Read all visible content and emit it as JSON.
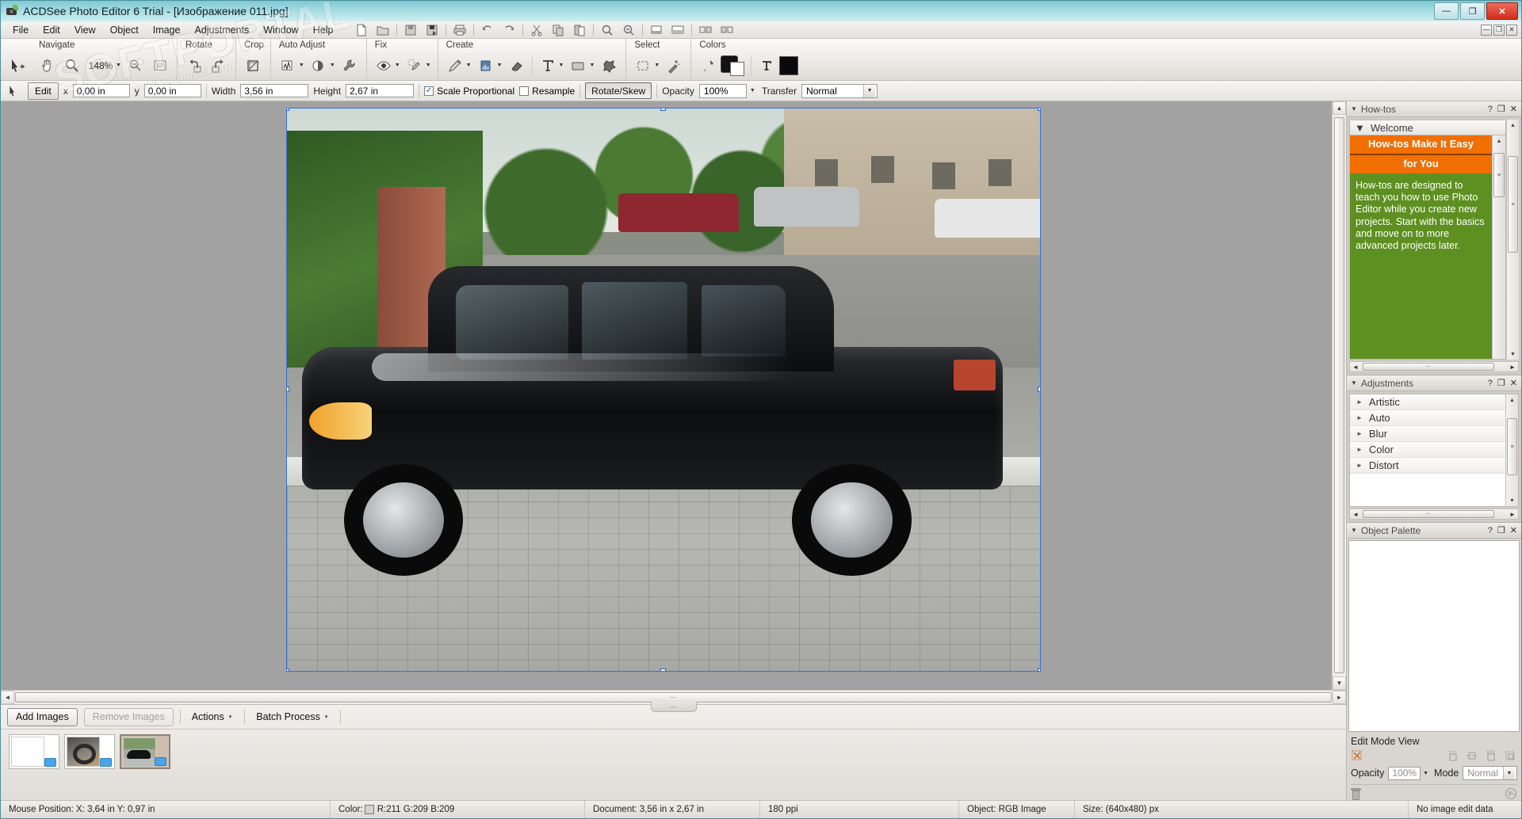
{
  "window": {
    "title": "ACDSee Photo Editor 6 Trial - [Изображение 011.jpg]",
    "app_icon": "camera-icon",
    "minimize": "—",
    "maximize": "❐",
    "close": "✕",
    "doc_restore": "—",
    "doc_max": "❐",
    "doc_close": "✕"
  },
  "menubar": {
    "items": [
      {
        "label": "File"
      },
      {
        "label": "Edit"
      },
      {
        "label": "View"
      },
      {
        "label": "Object"
      },
      {
        "label": "Image"
      },
      {
        "label": "Adjustments"
      },
      {
        "label": "Window"
      },
      {
        "label": "Help"
      }
    ],
    "quick_icons": [
      "new-document-icon",
      "open-folder-icon",
      "save-icon",
      "save-as-icon",
      "print-icon",
      "undo-icon",
      "redo-icon",
      "cut-icon",
      "copy-icon",
      "paste-icon",
      "zoom-in-icon",
      "zoom-out-icon",
      "fit-image-icon",
      "actual-size-icon",
      "compare-icon",
      "toggle-panels-icon"
    ]
  },
  "ribbon": {
    "groups": [
      {
        "label": "Navigate",
        "tools": [
          "select-move-icon",
          "pan-hand-icon",
          "zoom-magnifier-icon",
          "zoom-level",
          "zoom-out-icon",
          "fit-window-icon"
        ]
      },
      {
        "label": "Rotate",
        "tools": [
          "rotate-left-icon",
          "rotate-right-icon"
        ]
      },
      {
        "label": "Crop",
        "tools": [
          "crop-icon"
        ]
      },
      {
        "label": "Auto Adjust",
        "tools": [
          "auto-levels-icon",
          "auto-contrast-icon",
          "auto-repair-icon"
        ]
      },
      {
        "label": "Fix",
        "tools": [
          "red-eye-icon",
          "blemish-remover-icon"
        ]
      },
      {
        "label": "Create",
        "tools": [
          "draw-pen-icon",
          "fill-icon",
          "eraser-icon",
          "text-tool-icon",
          "shape-tool-icon",
          "freehand-shape-icon"
        ]
      },
      {
        "label": "Select",
        "tools": [
          "rectangle-select-icon",
          "magic-wand-icon"
        ]
      },
      {
        "label": "Colors",
        "tools": [
          "eyedropper-icon",
          "color-swatches-icon",
          "text-color-icon",
          "fill-color-icon"
        ]
      }
    ],
    "zoom_level": "148%"
  },
  "optionsbar": {
    "mode_badge": "Edit",
    "x_label": "x",
    "x_value": "0,00 in",
    "y_label": "y",
    "y_value": "0,00 in",
    "width_label": "Width",
    "width_value": "3,56 in",
    "height_label": "Height",
    "height_value": "2,67 in",
    "scale_proportional_label": "Scale Proportional",
    "scale_proportional_checked": true,
    "resample_label": "Resample",
    "resample_checked": false,
    "rotate_skew_label": "Rotate/Skew",
    "opacity_label": "Opacity",
    "opacity_value": "100%",
    "transfer_label": "Transfer",
    "transfer_value": "Normal"
  },
  "canvas": {
    "image_alt": "black-sedan-parked-on-street",
    "scroll_thumb_glyph": "≡",
    "up_arrow": "▲",
    "down_arrow": "▼",
    "left_arrow": "◄",
    "right_arrow": "►",
    "splitter_glyph": "⋯"
  },
  "filmstrip": {
    "add_images": "Add Images",
    "remove_images": "Remove Images",
    "actions": "Actions",
    "batch_process": "Batch Process",
    "caret": "▾",
    "thumbnails": [
      {
        "name": "blank-thumbnail",
        "kind": "blank",
        "selected": false
      },
      {
        "name": "car-interior-thumbnail",
        "kind": "interior",
        "selected": false
      },
      {
        "name": "black-car-thumbnail",
        "kind": "car",
        "selected": true
      }
    ]
  },
  "dock": {
    "howtos": {
      "title": "How-tos",
      "help_btn": "?",
      "restore_btn": "❐",
      "close_btn": "✕",
      "section": "Welcome",
      "banner_line1": "How-tos Make It Easy",
      "banner_line2": "for You",
      "body": "How-tos are designed to teach you how to use Photo Editor while you create new projects. Start with the basics and move on to more advanced projects later.",
      "banner_color": "#f06f00",
      "body_color": "#5e8f21"
    },
    "adjustments": {
      "title": "Adjustments",
      "help_btn": "?",
      "restore_btn": "❐",
      "close_btn": "✕",
      "items": [
        {
          "label": "Artistic"
        },
        {
          "label": "Auto"
        },
        {
          "label": "Blur"
        },
        {
          "label": "Color"
        },
        {
          "label": "Distort"
        }
      ]
    },
    "object_palette": {
      "title": "Object Palette",
      "help_btn": "?",
      "restore_btn": "❐",
      "close_btn": "✕",
      "edit_mode_view_label": "Edit Mode View",
      "opacity_label": "Opacity",
      "opacity_value": "100%",
      "mode_label": "Mode",
      "mode_value": "Normal",
      "icons": [
        "no-selection-icon",
        "align-top-icon",
        "align-center-icon",
        "distribute-icon",
        "group-icon",
        "delete-object-icon",
        "object-properties-icon"
      ]
    }
  },
  "statusbar": {
    "mouse_position": "Mouse Position: X: 3,64 in   Y: 0,97 in",
    "color_label": "Color:",
    "color_values": "R:211  G:209  B:209",
    "color_hex": "#d3d1d1",
    "document": "Document: 3,56 in x 2,67 in",
    "ppi": "180 ppi",
    "object": "Object: RGB Image",
    "size": "Size: (640x480) px",
    "edit_data": "No image edit data"
  },
  "watermark": {
    "text": "SOFTPORTAL",
    "sub": "www.softportal.com"
  }
}
